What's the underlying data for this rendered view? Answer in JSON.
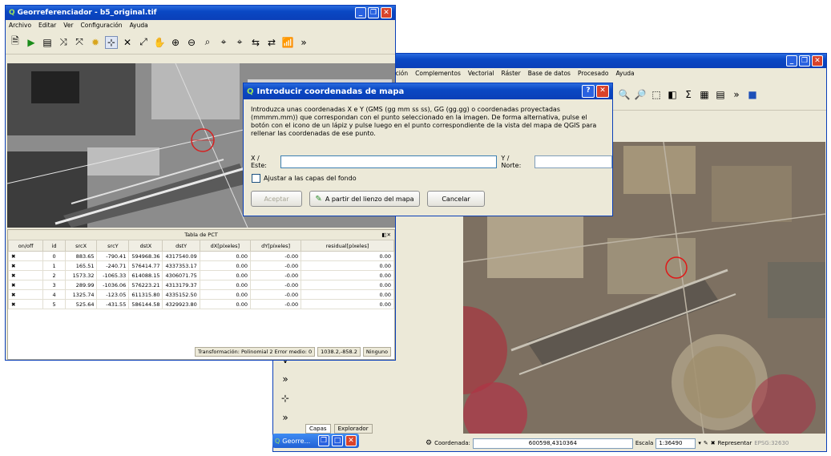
{
  "qgis": {
    "menu": [
      "ación",
      "Complementos",
      "Vectorial",
      "Ráster",
      "Base de datos",
      "Procesado",
      "Ayuda"
    ],
    "browser_tabs": [
      "Capas",
      "Explorador"
    ],
    "status": {
      "coord_label": "Coordenada:",
      "coord_value": "600598,4310364",
      "scale_label": "Escala",
      "scale_value": "1:36490",
      "render_label": "Representar",
      "crs": "EPSG:32630"
    }
  },
  "georef": {
    "title": "Georreferenciador - b5_original.tif",
    "menu": [
      "Archivo",
      "Editar",
      "Ver",
      "Configuración",
      "Ayuda"
    ],
    "table_title": "Tabla de PCT",
    "columns": [
      "on/off",
      "id",
      "srcX",
      "srcY",
      "dstX",
      "dstY",
      "dX[píxeles]",
      "dY[píxeles]",
      "residual[píxeles]"
    ],
    "rows": [
      [
        "",
        "0",
        "883.65",
        "-790.41",
        "594968.36",
        "4317540.09",
        "0.00",
        "-0.00",
        "0.00"
      ],
      [
        "",
        "1",
        "165.51",
        "-240.71",
        "576414.77",
        "4337353.17",
        "0.00",
        "-0.00",
        "0.00"
      ],
      [
        "",
        "2",
        "1573.32",
        "-1065.33",
        "614088.15",
        "4306071.75",
        "0.00",
        "-0.00",
        "0.00"
      ],
      [
        "",
        "3",
        "289.99",
        "-1036.06",
        "576223.21",
        "4313179.37",
        "0.00",
        "-0.00",
        "0.00"
      ],
      [
        "",
        "4",
        "1325.74",
        "-123.05",
        "611315.80",
        "4335152.50",
        "0.00",
        "-0.00",
        "0.00"
      ],
      [
        "",
        "5",
        "525.64",
        "-431.55",
        "586144.58",
        "4329923.80",
        "0.00",
        "-0.00",
        "0.00"
      ]
    ],
    "status": {
      "transform": "Transformación: Polinomial 2 Error medio: 0",
      "coords": "1038.2,-858.2",
      "crs": "Ninguno"
    }
  },
  "dialog": {
    "title": "Introducir coordenadas de mapa",
    "description": "Introduzca unas coordenadas X e Y (GMS (gg mm ss ss), GG (gg.gg) o coordenadas proyectadas (mmmm.mm)) que correspondan con el punto seleccionado en la imagen. De forma alternativa, pulse el botón con el icono de un lápiz y pulse luego en el punto correspondiente de la vista del mapa de QGIS para rellenar las coordenadas de ese punto.",
    "x_label": "X / Este:",
    "x_value": "",
    "y_label": "Y / Norte:",
    "y_value": "",
    "checkbox_label": "Ajustar a las capas del fondo",
    "accept": "Aceptar",
    "from_canvas": "A partir del lienzo del mapa",
    "cancel": "Cancelar"
  },
  "taskbar": {
    "label": "Georre..."
  }
}
